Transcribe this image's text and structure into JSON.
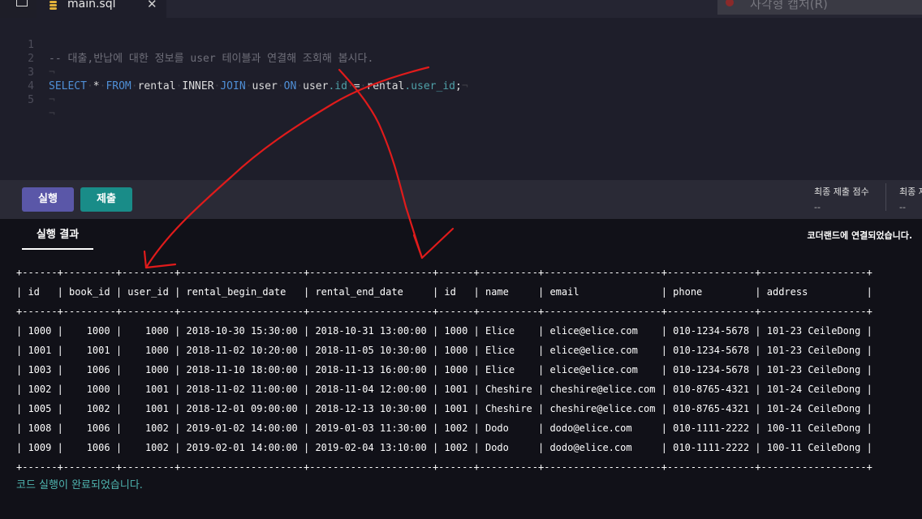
{
  "editor": {
    "file_name": "main.sql",
    "close_glyph": "✕",
    "ghost_tooltip": "사각형 캡처(R)",
    "lines": [
      {
        "num": "1",
        "comment": "-- 대출,반납에 대한 정보를 user 테이블과 연결해 조회해 봅시다."
      },
      {
        "num": "2"
      },
      {
        "num": "3",
        "tokens": {
          "select": "SELECT",
          "star": "*",
          "from": "FROM",
          "rental": "rental",
          "inner": "INNER",
          "join": "JOIN",
          "user": "user",
          "on": "ON",
          "user_tbl": "user",
          "user_id_col": "id",
          "eq": "=",
          "rental_tbl": "rental",
          "rental_col": "user_id",
          "semi": ";"
        }
      },
      {
        "num": "4"
      },
      {
        "num": "5"
      }
    ]
  },
  "toolbar": {
    "run_label": "실행",
    "submit_label": "제출",
    "final_score_label": "최종 제출 점수",
    "final_score_value": "--",
    "second_score_label": "최종 제",
    "second_score_value": "--"
  },
  "results": {
    "tab_label": "실행 결과",
    "connection_status": "코더랜드에 연결되었습니다.",
    "columns": [
      "id",
      "book_id",
      "user_id",
      "rental_begin_date",
      "rental_end_date",
      "id",
      "name",
      "email",
      "phone",
      "address"
    ],
    "rows": [
      [
        "1000",
        "1000",
        "1000",
        "2018-10-30 15:30:00",
        "2018-10-31 13:00:00",
        "1000",
        "Elice",
        "elice@elice.com",
        "010-1234-5678",
        "101-23 CeileDong"
      ],
      [
        "1001",
        "1001",
        "1000",
        "2018-11-02 10:20:00",
        "2018-11-05 10:30:00",
        "1000",
        "Elice",
        "elice@elice.com",
        "010-1234-5678",
        "101-23 CeileDong"
      ],
      [
        "1003",
        "1006",
        "1000",
        "2018-11-10 18:00:00",
        "2018-11-13 16:00:00",
        "1000",
        "Elice",
        "elice@elice.com",
        "010-1234-5678",
        "101-23 CeileDong"
      ],
      [
        "1002",
        "1000",
        "1001",
        "2018-11-02 11:00:00",
        "2018-11-04 12:00:00",
        "1001",
        "Cheshire",
        "cheshire@elice.com",
        "010-8765-4321",
        "101-24 CeileDong"
      ],
      [
        "1005",
        "1002",
        "1001",
        "2018-12-01 09:00:00",
        "2018-12-13 10:30:00",
        "1001",
        "Cheshire",
        "cheshire@elice.com",
        "010-8765-4321",
        "101-24 CeileDong"
      ],
      [
        "1008",
        "1006",
        "1002",
        "2019-01-02 14:00:00",
        "2019-01-03 11:30:00",
        "1002",
        "Dodo",
        "dodo@elice.com",
        "010-1111-2222",
        "100-11 CeileDong"
      ],
      [
        "1009",
        "1006",
        "1002",
        "2019-02-01 14:00:00",
        "2019-02-04 13:10:00",
        "1002",
        "Dodo",
        "dodo@elice.com",
        "010-1111-2222",
        "100-11 CeileDong"
      ]
    ],
    "done_message": "코드 실행이 완료되었습니다."
  },
  "annotation": {
    "color": "#e01b1b"
  }
}
